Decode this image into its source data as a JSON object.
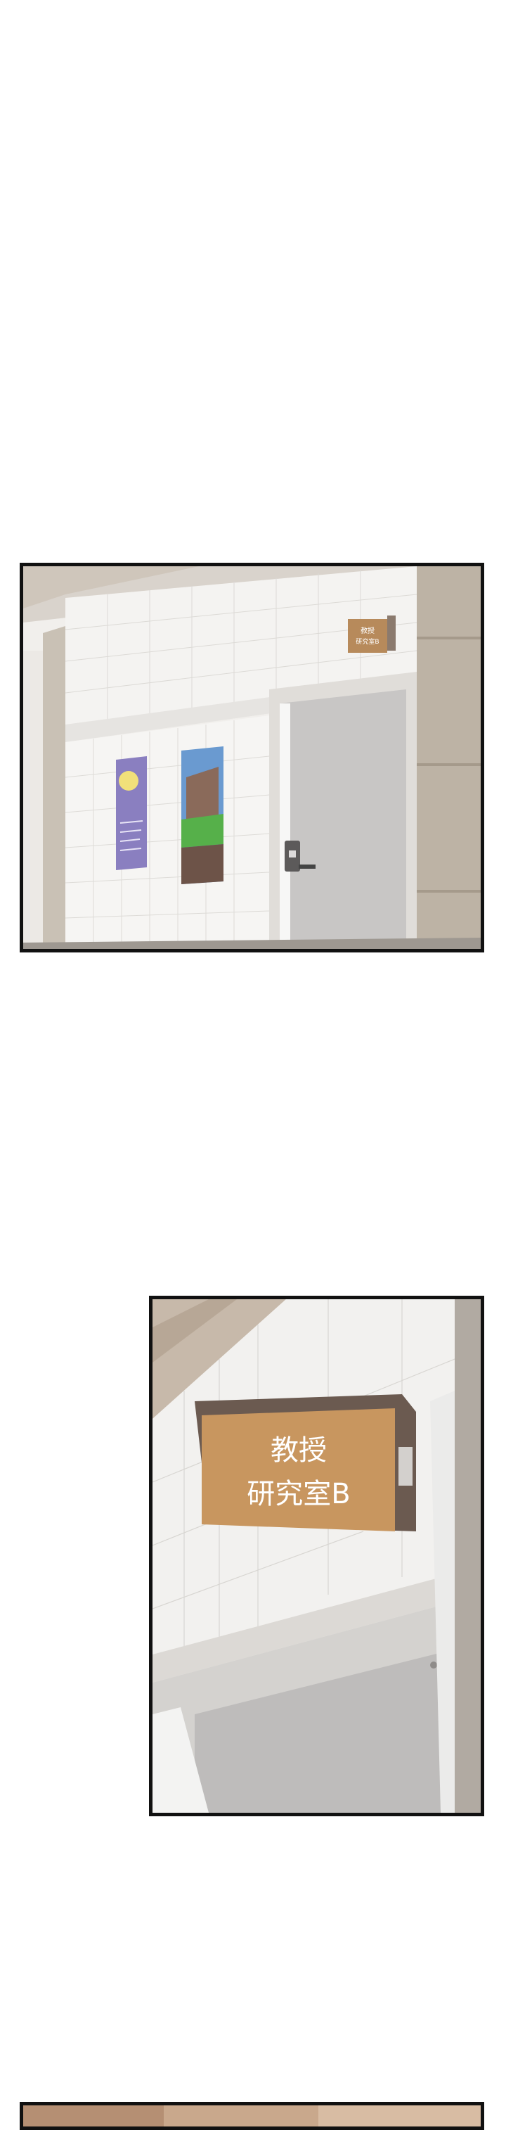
{
  "panels": [
    {
      "id": "hallway-wide-shot",
      "sign_small_lines": [
        "教授",
        "研究室B"
      ]
    },
    {
      "id": "office-sign-closeup",
      "sign": {
        "line1": "教授",
        "line2": "研究室B"
      }
    },
    {
      "id": "next-panel-top-edge"
    }
  ],
  "colors": {
    "border": "#111111",
    "wall_tile": "#f3f2f0",
    "sign_face": "#c8965f",
    "sign_side": "#6b5a50",
    "door": "#c9c7c6",
    "pillar": "#bdb3a5"
  }
}
